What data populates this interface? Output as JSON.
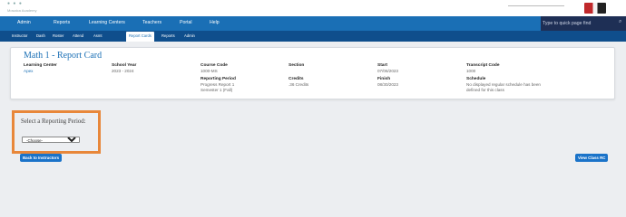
{
  "brand": {
    "logo_text": "Mosaica Academy"
  },
  "main_nav": {
    "items": [
      "Admin",
      "Reports",
      "Learning Centers",
      "Teachers",
      "Portal",
      "Help"
    ]
  },
  "quick_search": {
    "placeholder": "Type to quick page find",
    "icon": "search-icon"
  },
  "sub_nav": {
    "items": [
      "Instructor",
      "Dash",
      "Roster",
      "Attend",
      "Asmt",
      "Report Cards",
      "Reports",
      "Admin"
    ],
    "active": "Report Cards"
  },
  "report_card": {
    "title": "Math 1 - Report Card",
    "learning_center": {
      "label": "Learning Center",
      "value": "Apex"
    },
    "school_year": {
      "label": "School Year",
      "value": "2023 - 2024"
    },
    "course_code": {
      "label": "Course Code",
      "value": "1000-MS"
    },
    "reporting_period": {
      "label": "Reporting Period",
      "line1": "Progress Report 1",
      "line2": "Semester 1 (Fall)"
    },
    "section": {
      "label": "Section",
      "value": ""
    },
    "credits": {
      "label": "Credits",
      "value": ".36 Credits"
    },
    "start": {
      "label": "Start",
      "value": "07/06/2023"
    },
    "finish": {
      "label": "Finish",
      "value": "08/30/2023"
    },
    "transcript_code": {
      "label": "Transcript Code",
      "value": "1000"
    },
    "schedule": {
      "label": "Schedule",
      "line1": "No displayed regular schedule has been",
      "line2": "defined for this class"
    }
  },
  "reporting_period_select": {
    "label": "Select a Reporting Period:",
    "selected": "-Choose-",
    "options": [
      "-Choose-"
    ]
  },
  "buttons": {
    "back": "Back to Instructors",
    "view_class": "View Class RC"
  },
  "colors": {
    "nav_blue": "#1a6fb5",
    "subnav_blue": "#0f4e8c",
    "search_bg": "#1e2f55",
    "highlight_orange": "#e8873a",
    "button_blue": "#1a73c9"
  }
}
